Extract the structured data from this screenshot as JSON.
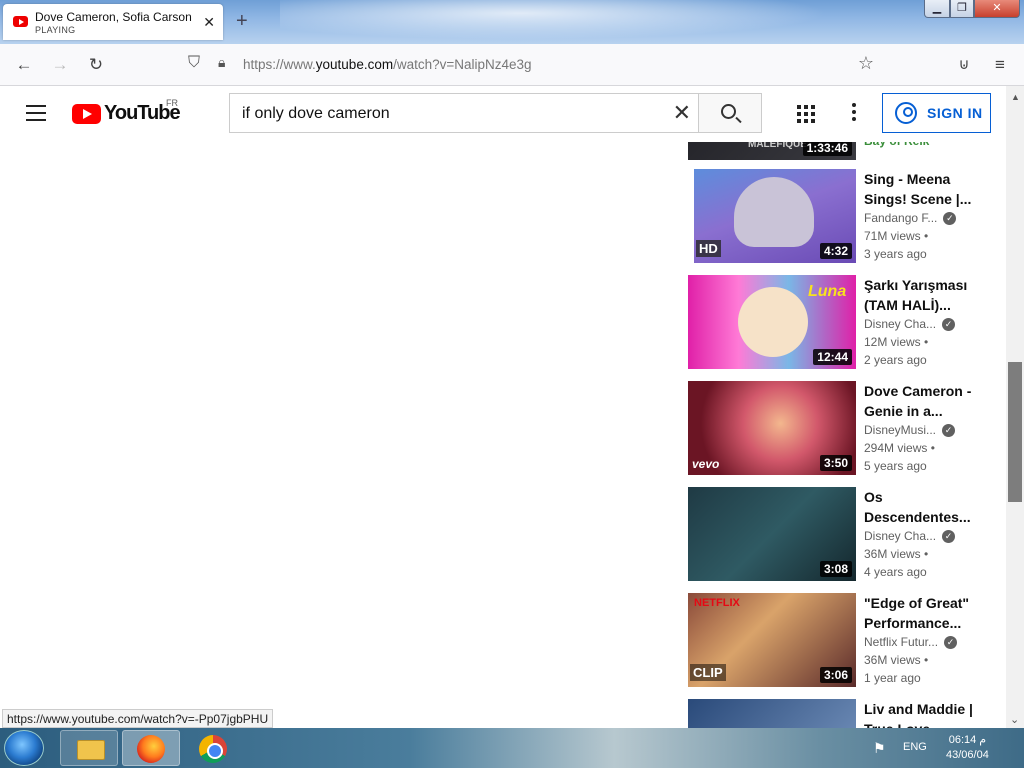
{
  "browser": {
    "tab_title": "Dove Cameron, Sofia Carson - S",
    "tab_subtitle": "PLAYING",
    "url_prefix": "https://www.",
    "url_domain": "youtube.com",
    "url_path": "/watch?v=NalipNz4e3g",
    "status_url": "https://www.youtube.com/watch?v=-Pp07jgbPHU",
    "icons": [
      "back-icon",
      "forward-icon",
      "reload-icon",
      "shield-icon",
      "lock-icon",
      "star-icon",
      "pocket-icon",
      "menu-icon"
    ]
  },
  "youtube": {
    "logo_text": "YouTube",
    "country_code": "FR",
    "search_query": "if only dove cameron",
    "signin_label": "SIGN IN",
    "accent_color": "#065fd4",
    "brand_red": "#ff0000"
  },
  "recommendations": [
    {
      "title": "",
      "channel": "",
      "views": "",
      "age": "",
      "duration": "1:33:46",
      "partial_text": "Bay of Reik",
      "thumb_label": "MALEFIQUE"
    },
    {
      "title": "Sing - Meena Sings! Scene |...",
      "channel": "Fandango F...",
      "verified": true,
      "views": "71M views •",
      "age": "3 years ago",
      "duration": "4:32",
      "badge": "HD"
    },
    {
      "title": "Şarkı Yarışması (TAM HALİ)...",
      "channel": "Disney Cha...",
      "verified": true,
      "views": "12M views •",
      "age": "2 years ago",
      "duration": "12:44",
      "thumb_label": "Luna"
    },
    {
      "title": "Dove Cameron - Genie in a...",
      "channel": "DisneyMusi...",
      "verified": true,
      "views": "294M views •",
      "age": "5 years ago",
      "duration": "3:50",
      "thumb_label": "vevo"
    },
    {
      "title": "Os Descendentes...",
      "channel": "Disney Cha...",
      "verified": true,
      "views": "36M views •",
      "age": "4 years ago",
      "duration": "3:08"
    },
    {
      "title": "\"Edge of Great\" Performance...",
      "channel": "Netflix Futur...",
      "verified": true,
      "views": "36M views •",
      "age": "1 year ago",
      "duration": "3:06",
      "thumb_label": "NETFLIX",
      "badge": "CLIP"
    },
    {
      "title": "Liv and Maddie | True Love",
      "channel": "",
      "views": "",
      "age": "",
      "duration": ""
    }
  ],
  "taskbar": {
    "lang": "ENG",
    "time": "06:14 م",
    "date": "43/06/04"
  }
}
